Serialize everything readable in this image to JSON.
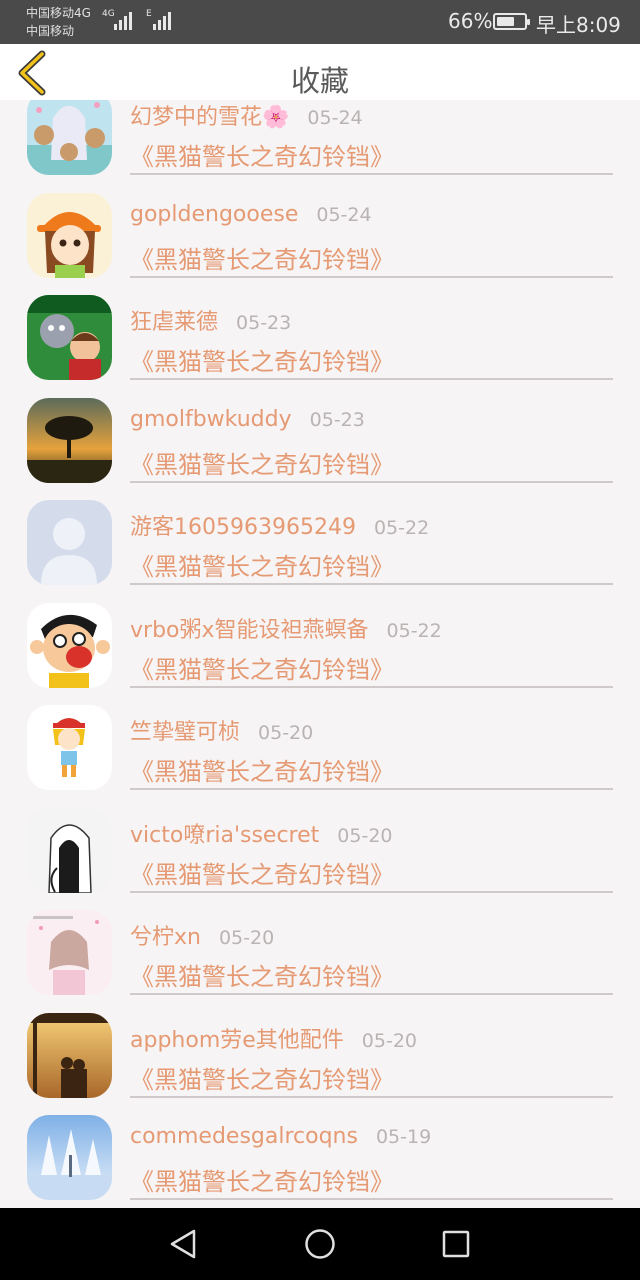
{
  "status": {
    "carrier1": "中国移动4G",
    "carrier2": "中国移动",
    "net1": "4G",
    "net2": "E",
    "battery_pct": "66%",
    "battery_level": 0.66,
    "time": "早上8:09"
  },
  "header": {
    "title": "收藏",
    "back_icon": "chevron-left-icon"
  },
  "items": [
    {
      "name": "幻梦中的雪花🌸",
      "date": "05-24",
      "book": "《黑猫警长之奇幻铃铛》",
      "avatar": "anime-girl-with-bears"
    },
    {
      "name": "gopldengooese",
      "date": "05-24",
      "book": "《黑猫警长之奇幻铃铛》",
      "avatar": "cartoon-girl-orange-hat"
    },
    {
      "name": "狂虐莱德",
      "date": "05-23",
      "book": "《黑猫警长之奇幻铃铛》",
      "avatar": "cartoon-characters-green"
    },
    {
      "name": "gmolfbwkuddy",
      "date": "05-23",
      "book": "《黑猫警长之奇幻铃铛》",
      "avatar": "sunset-tree"
    },
    {
      "name": "游客1605963965249",
      "date": "05-22",
      "book": "《黑猫警长之奇幻铃铛》",
      "avatar": "default-user"
    },
    {
      "name": "vrbo粥x智能设袒燕螟备",
      "date": "05-22",
      "book": "《黑猫警长之奇幻铃铛》",
      "avatar": "cartoon-boy-laughing"
    },
    {
      "name": "竺挚璧可桢",
      "date": "05-20",
      "book": "《黑猫警长之奇幻铃铛》",
      "avatar": "cartoon-kid-red-cap"
    },
    {
      "name": "victo嘹ria'ssecret",
      "date": "05-20",
      "book": "《黑猫警长之奇幻铃铛》",
      "avatar": "sketch-hooded-figure"
    },
    {
      "name": "兮柠xn",
      "date": "05-20",
      "book": "《黑猫警长之奇幻铃铛》",
      "avatar": "anime-girl-pastel"
    },
    {
      "name": "apphom劳e其他配件",
      "date": "05-20",
      "book": "《黑猫警长之奇幻铃铛》",
      "avatar": "sunset-couple"
    },
    {
      "name": "commedesgalrcoqns",
      "date": "05-19",
      "book": "《黑猫警长之奇幻铃铛》",
      "avatar": "snowy-forest"
    }
  ],
  "navbar": {
    "back": "triangle-back-icon",
    "home": "circle-home-icon",
    "recent": "square-recent-icon"
  }
}
